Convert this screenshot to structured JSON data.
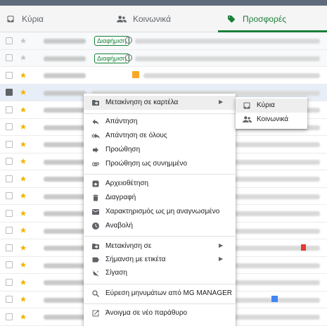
{
  "tabs": [
    {
      "label": "Κύρια",
      "icon": "inbox-icon",
      "active": false
    },
    {
      "label": "Κοινωνικά",
      "icon": "people-icon",
      "active": false
    },
    {
      "label": "Προσφορές",
      "icon": "tag-icon",
      "active": true
    }
  ],
  "colors": {
    "accent": "#188038",
    "star": "#f4b400"
  },
  "promo_badge": "Διαφήμιση",
  "context_menu": {
    "move_to_tab": "Μετακίνηση σε καρτέλα",
    "reply": "Απάντηση",
    "reply_all": "Απάντηση σε όλους",
    "forward": "Προώθηση",
    "forward_attachment": "Προώθηση ως συνημμένο",
    "archive": "Αρχειοθέτηση",
    "delete": "Διαγραφή",
    "mark_unread": "Χαρακτηρισμός ως μη αναγνωσμένο",
    "snooze": "Αναβολή",
    "move_to": "Μετακίνηση σε",
    "label_as": "Σήμανση με ετικέτα",
    "mute": "Σίγαση",
    "find_from": "Εύρεση μηνυμάτων από MG MANAGER",
    "open_new_window": "Άνοιγμα σε νέο παράθυρο"
  },
  "submenu": {
    "primary": "Κύρια",
    "social": "Κοινωνικά"
  }
}
